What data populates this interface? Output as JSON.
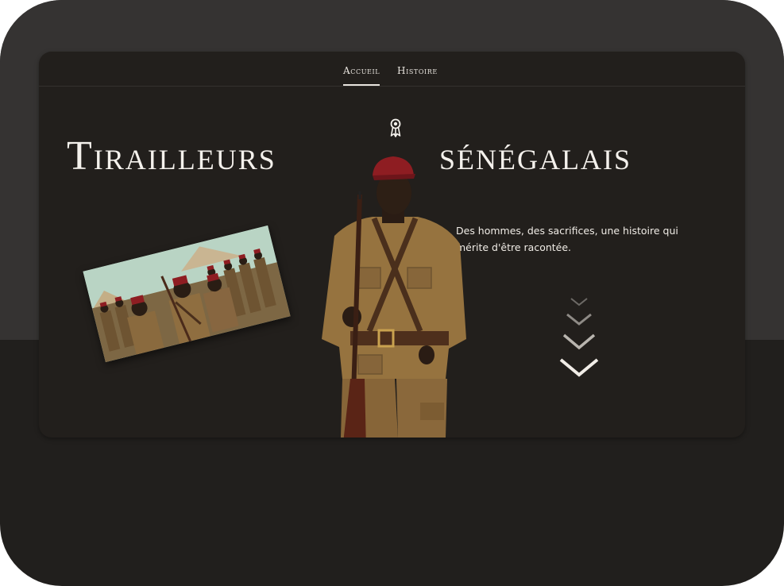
{
  "nav": {
    "items": [
      {
        "label": "Accueil",
        "active": true
      },
      {
        "label": "Histoire",
        "active": false
      }
    ]
  },
  "hero": {
    "title_left": "Tirailleurs",
    "title_right": "sénégalais",
    "tagline": "Des hommes, des sacrifices, une histoire qui mérite d'être racontée.",
    "icons": {
      "ribbon": "award-ribbon-icon",
      "scroll": "chevrons-down-icon"
    }
  },
  "colors": {
    "background_outer": "#353332",
    "background_inner": "#221f1c",
    "text": "#f4f1ec",
    "uniform": "#8a6a3e",
    "fez": "#8e1d22"
  }
}
